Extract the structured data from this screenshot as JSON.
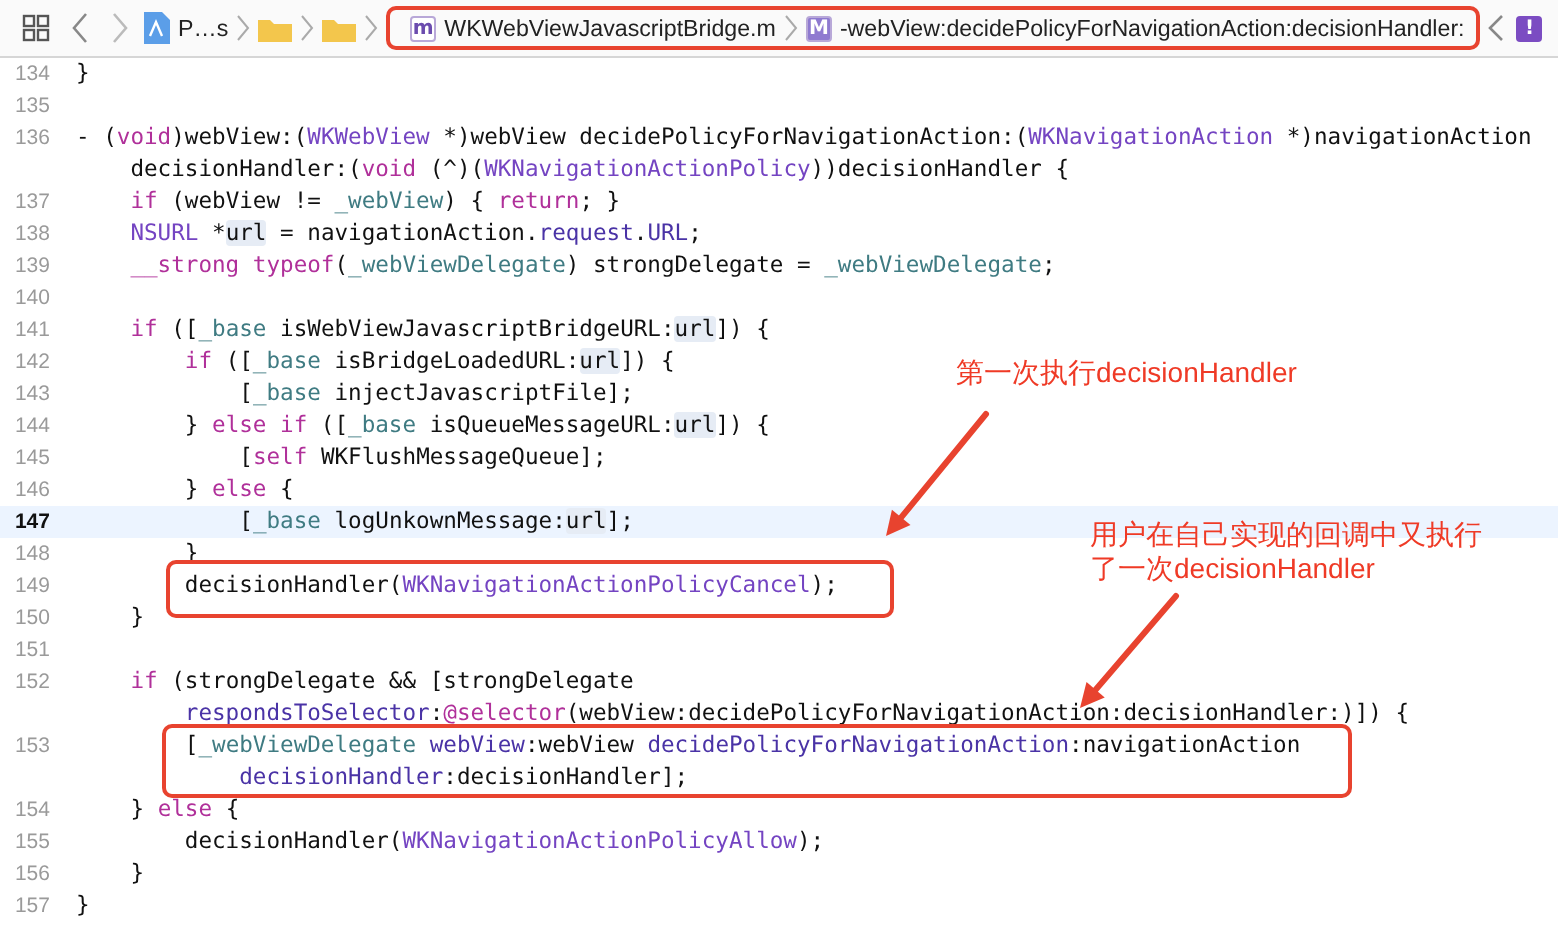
{
  "toolbar": {
    "project": "P…s",
    "file_badge": "m",
    "file": "WKWebViewJavascriptBridge.m",
    "method_badge": "M",
    "method": "-webView:decidePolicyForNavigationAction:decisionHandler:",
    "issue_badge": "!"
  },
  "rows": [
    {
      "number": "134",
      "current": false,
      "lines": [
        [
          {
            "text": "}",
            "kind": "plain"
          }
        ]
      ]
    },
    {
      "number": "135",
      "current": false
    },
    {
      "number": "136",
      "current": false,
      "lines": [
        [
          {
            "text": "- (",
            "kind": "plain"
          },
          {
            "text": "void",
            "kind": "keyword"
          },
          {
            "text": ")webView:(",
            "kind": "plain"
          },
          {
            "text": "WKWebView",
            "kind": "type"
          },
          {
            "text": " *)webView decidePolicyForNavigationAction:(",
            "kind": "plain"
          },
          {
            "text": "WKNavigationAction",
            "kind": "type"
          },
          {
            "text": " *)navigationAction",
            "kind": "plain"
          }
        ],
        [
          {
            "text": "    decisionHandler:(",
            "kind": "plain"
          },
          {
            "text": "void",
            "kind": "keyword"
          },
          {
            "text": " (^)(",
            "kind": "plain"
          },
          {
            "text": "WKNavigationActionPolicy",
            "kind": "type"
          },
          {
            "text": "))decisionHandler {",
            "kind": "plain"
          }
        ]
      ]
    },
    {
      "number": "137",
      "current": false,
      "lines": [
        [
          {
            "text": "    if",
            "kind": "keyword"
          },
          {
            "text": " (webView != ",
            "kind": "plain"
          },
          {
            "text": "_webView",
            "kind": "ivar"
          },
          {
            "text": ") { ",
            "kind": "plain"
          },
          {
            "text": "return",
            "kind": "keyword"
          },
          {
            "text": "; }",
            "kind": "plain"
          }
        ]
      ]
    },
    {
      "number": "138",
      "current": false,
      "lines": [
        [
          {
            "text": "    NSURL",
            "kind": "type"
          },
          {
            "text": " *",
            "kind": "plain"
          },
          {
            "text": "url",
            "kind": "url"
          },
          {
            "text": " = navigationAction.",
            "kind": "plain"
          },
          {
            "text": "request",
            "kind": "method"
          },
          {
            "text": ".",
            "kind": "plain"
          },
          {
            "text": "URL",
            "kind": "method"
          },
          {
            "text": ";",
            "kind": "plain"
          }
        ]
      ]
    },
    {
      "number": "139",
      "current": false,
      "lines": [
        [
          {
            "text": "    __strong typeof",
            "kind": "keyword"
          },
          {
            "text": "(",
            "kind": "plain"
          },
          {
            "text": "_webViewDelegate",
            "kind": "ivar"
          },
          {
            "text": ") strongDelegate = ",
            "kind": "plain"
          },
          {
            "text": "_webViewDelegate",
            "kind": "ivar"
          },
          {
            "text": ";",
            "kind": "plain"
          }
        ]
      ]
    },
    {
      "number": "140",
      "current": false
    },
    {
      "number": "141",
      "current": false,
      "lines": [
        [
          {
            "text": "    if",
            "kind": "keyword"
          },
          {
            "text": " ([",
            "kind": "plain"
          },
          {
            "text": "_base",
            "kind": "ivar"
          },
          {
            "text": " isWebViewJavascriptBridgeURL:",
            "kind": "plain"
          },
          {
            "text": "url",
            "kind": "url"
          },
          {
            "text": "]) {",
            "kind": "plain"
          }
        ]
      ]
    },
    {
      "number": "142",
      "current": false,
      "lines": [
        [
          {
            "text": "        if",
            "kind": "keyword"
          },
          {
            "text": " ([",
            "kind": "plain"
          },
          {
            "text": "_base",
            "kind": "ivar"
          },
          {
            "text": " isBridgeLoadedURL:",
            "kind": "plain"
          },
          {
            "text": "url",
            "kind": "url"
          },
          {
            "text": "]) {",
            "kind": "plain"
          }
        ]
      ]
    },
    {
      "number": "143",
      "current": false,
      "lines": [
        [
          {
            "text": "            [",
            "kind": "plain"
          },
          {
            "text": "_base",
            "kind": "ivar"
          },
          {
            "text": " injectJavascriptFile];",
            "kind": "plain"
          }
        ]
      ]
    },
    {
      "number": "144",
      "current": false,
      "lines": [
        [
          {
            "text": "        } ",
            "kind": "plain"
          },
          {
            "text": "else if",
            "kind": "keyword"
          },
          {
            "text": " ([",
            "kind": "plain"
          },
          {
            "text": "_base",
            "kind": "ivar"
          },
          {
            "text": " isQueueMessageURL:",
            "kind": "plain"
          },
          {
            "text": "url",
            "kind": "url"
          },
          {
            "text": "]) {",
            "kind": "plain"
          }
        ]
      ]
    },
    {
      "number": "145",
      "current": false,
      "lines": [
        [
          {
            "text": "            [",
            "kind": "plain"
          },
          {
            "text": "self",
            "kind": "keyword"
          },
          {
            "text": " WKFlushMessageQueue];",
            "kind": "plain"
          }
        ]
      ]
    },
    {
      "number": "146",
      "current": false,
      "lines": [
        [
          {
            "text": "        } ",
            "kind": "plain"
          },
          {
            "text": "else",
            "kind": "keyword"
          },
          {
            "text": " {",
            "kind": "plain"
          }
        ]
      ]
    },
    {
      "number": "147",
      "current": true,
      "lines": [
        [
          {
            "text": "            [",
            "kind": "plain"
          },
          {
            "text": "_base",
            "kind": "ivar"
          },
          {
            "text": " logUnkownMessage:",
            "kind": "plain"
          },
          {
            "text": "url",
            "kind": "url"
          },
          {
            "text": "];",
            "kind": "plain"
          }
        ]
      ]
    },
    {
      "number": "148",
      "current": false,
      "lines": [
        [
          {
            "text": "        }",
            "kind": "plain"
          }
        ]
      ]
    },
    {
      "number": "149",
      "current": false,
      "lines": [
        [
          {
            "text": "        decisionHandler(",
            "kind": "plain"
          },
          {
            "text": "WKNavigationActionPolicyCancel",
            "kind": "type"
          },
          {
            "text": ");",
            "kind": "plain"
          }
        ]
      ]
    },
    {
      "number": "150",
      "current": false,
      "lines": [
        [
          {
            "text": "    }",
            "kind": "plain"
          }
        ]
      ]
    },
    {
      "number": "151",
      "current": false
    },
    {
      "number": "152",
      "current": false,
      "lines": [
        [
          {
            "text": "    if",
            "kind": "keyword"
          },
          {
            "text": " (strongDelegate && [strongDelegate",
            "kind": "plain"
          }
        ],
        [
          {
            "text": "        respondsToSelector",
            "kind": "method"
          },
          {
            "text": ":",
            "kind": "plain"
          },
          {
            "text": "@selector",
            "kind": "keyword"
          },
          {
            "text": "(webView:decidePolicyForNavigationAction:decisionHandler:)]) {",
            "kind": "plain"
          }
        ]
      ]
    },
    {
      "number": "153",
      "current": false,
      "lines": [
        [
          {
            "text": "        [",
            "kind": "plain"
          },
          {
            "text": "_webViewDelegate",
            "kind": "ivar"
          },
          {
            "text": " webView",
            "kind": "method"
          },
          {
            "text": ":webView ",
            "kind": "plain"
          },
          {
            "text": "decidePolicyForNavigationAction",
            "kind": "method"
          },
          {
            "text": ":navigationAction",
            "kind": "plain"
          }
        ],
        [
          {
            "text": "            decisionHandler",
            "kind": "method"
          },
          {
            "text": ":decisionHandler];",
            "kind": "plain"
          }
        ]
      ]
    },
    {
      "number": "154",
      "current": false,
      "lines": [
        [
          {
            "text": "    } ",
            "kind": "plain"
          },
          {
            "text": "else",
            "kind": "keyword"
          },
          {
            "text": " {",
            "kind": "plain"
          }
        ]
      ]
    },
    {
      "number": "155",
      "current": false,
      "lines": [
        [
          {
            "text": "        decisionHandler(",
            "kind": "plain"
          },
          {
            "text": "WKNavigationActionPolicyAllow",
            "kind": "type"
          },
          {
            "text": ");",
            "kind": "plain"
          }
        ]
      ]
    },
    {
      "number": "156",
      "current": false,
      "lines": [
        [
          {
            "text": "    }",
            "kind": "plain"
          }
        ]
      ]
    },
    {
      "number": "157",
      "current": false,
      "lines": [
        [
          {
            "text": "}",
            "kind": "plain"
          }
        ]
      ]
    }
  ],
  "annotations": [
    {
      "text": "第一次执行decisionHandler"
    },
    {
      "text": "用户在自己实现的回调中又执行了一次decisionHandler"
    }
  ]
}
